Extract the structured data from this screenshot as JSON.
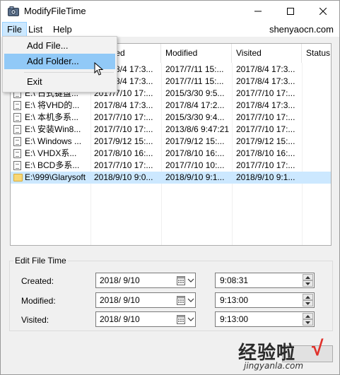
{
  "window": {
    "title": "ModifyFileTime"
  },
  "menubar": {
    "items": [
      "File",
      "List",
      "Help"
    ],
    "site": "shenyaocn.com"
  },
  "file_menu": {
    "items": [
      "Add File...",
      "Add Folder...",
      "Exit"
    ],
    "highlighted": "Add Folder..."
  },
  "listview": {
    "columns": [
      "",
      "Created",
      "Modified",
      "Visited",
      "Status"
    ],
    "rows": [
      {
        "name": "",
        "created": "2018/8/4 17:3...",
        "modified": "2017/7/11 15:...",
        "visited": "2017/8/4 17:3...",
        "icon": "file-icon"
      },
      {
        "name": "",
        "created": "2018/8/4 17:3...",
        "modified": "2017/7/11 15:...",
        "visited": "2017/8/4 17:3...",
        "icon": "file-icon"
      },
      {
        "name": "E:\\  日式键盘...",
        "created": "2017/7/10 17:...",
        "modified": "2015/3/30 9:5...",
        "visited": "2017/7/10 17:...",
        "icon": "file-icon"
      },
      {
        "name": "E:\\  将VHD的...",
        "created": "2017/8/4 17:3...",
        "modified": "2017/8/4 17:2...",
        "visited": "2017/8/4 17:3...",
        "icon": "file-icon"
      },
      {
        "name": "E:\\  本机多系...",
        "created": "2017/7/10 17:...",
        "modified": "2015/3/30 9:4...",
        "visited": "2017/7/10 17:...",
        "icon": "file-icon"
      },
      {
        "name": "E:\\  安装Win8...",
        "created": "2017/7/10 17:...",
        "modified": "2013/8/6 9:47:21",
        "visited": "2017/7/10 17:...",
        "icon": "file-icon"
      },
      {
        "name": "E:\\  Windows ...",
        "created": "2017/9/12 15:...",
        "modified": "2017/9/12 15:...",
        "visited": "2017/9/12 15:...",
        "icon": "file-icon"
      },
      {
        "name": "E:\\  VHDX系...",
        "created": "2017/8/10 16:...",
        "modified": "2017/8/10 16:...",
        "visited": "2017/8/10 16:...",
        "icon": "file-icon"
      },
      {
        "name": "E:\\  BCD多系...",
        "created": "2017/7/10 17:...",
        "modified": "2017/7/10 10:...",
        "visited": "2017/7/10 17:...",
        "icon": "file-icon"
      },
      {
        "name": "E:\\999\\Glarysoft",
        "created": "2018/9/10 9:0...",
        "modified": "2018/9/10 9:1...",
        "visited": "2018/9/10 9:1...",
        "icon": "folder-icon",
        "selected": true
      }
    ]
  },
  "edit_time": {
    "title": "Edit File Time",
    "rows": [
      {
        "label": "Created:",
        "date": "2018/  9/10",
        "time": "9:08:31"
      },
      {
        "label": "Modified:",
        "date": "2018/  9/10",
        "time": "9:13:00"
      },
      {
        "label": "Visited:",
        "date": "2018/  9/10",
        "time": "9:13:00"
      }
    ]
  },
  "watermark": {
    "main": "经验啦",
    "check": "√",
    "sub": "jingyanla.com"
  },
  "colors": {
    "selection": "#cce8ff",
    "menu_highlight": "#91c9f7",
    "accent_check": "#e0302a"
  }
}
